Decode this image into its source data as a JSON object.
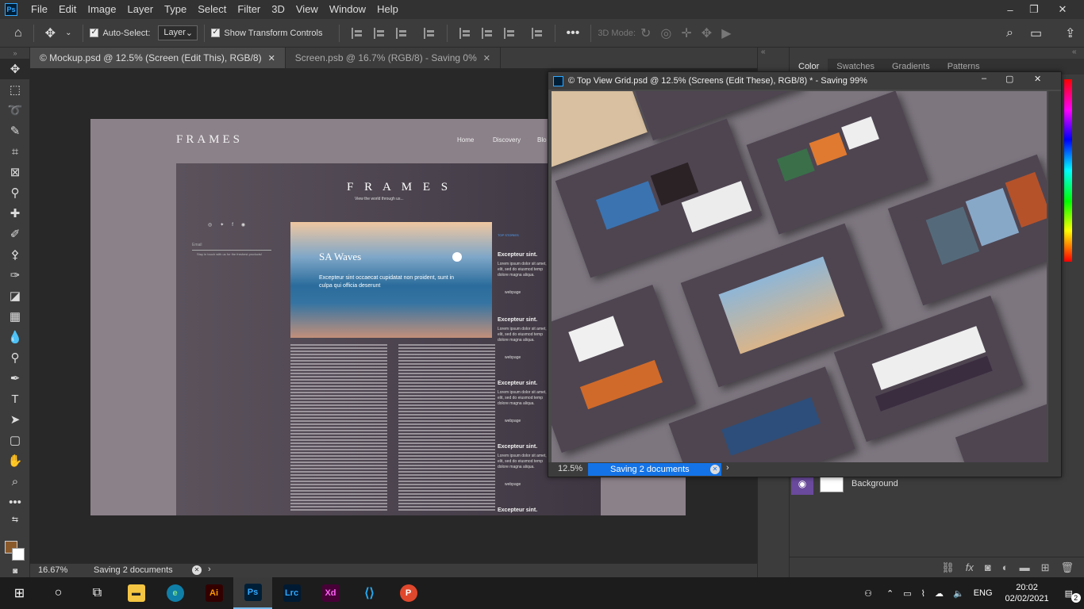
{
  "app": {
    "logo": "Ps",
    "brand_color": "#31a8ff"
  },
  "menu": [
    "File",
    "Edit",
    "Image",
    "Layer",
    "Type",
    "Select",
    "Filter",
    "3D",
    "View",
    "Window",
    "Help"
  ],
  "window_controls": [
    "–",
    "❐",
    "✕"
  ],
  "options": {
    "auto_select_label": "Auto-Select:",
    "auto_select_value": "Layer",
    "transform_label": "Show Transform Controls",
    "mode_3d_label": "3D Mode:"
  },
  "tabs": [
    {
      "label": "© Mockup.psd @ 12.5% (Screen (Edit This), RGB/8)"
    },
    {
      "label": "Screen.psb @ 16.7% (RGB/8) - Saving 0%"
    }
  ],
  "mockup": {
    "logo": "FRAMES",
    "nav": [
      "Home",
      "Discovery",
      "Blo"
    ],
    "inner_logo": "F R A M E S",
    "inner_tagline": "View the world through us...",
    "email_placeholder": "Email",
    "newsletter": "Stay in touch with us for the freshest products!",
    "hero_title": "SA Waves",
    "hero_text": "Excepteur sint occaecat cupidatat non proident, sunt in culpa qui officia deserunt",
    "top_stories": "TOP STORIES",
    "side_heads": [
      "Excepteur sint.",
      "Excepteur sint.",
      "Excepteur sint.",
      "Excepteur sint.",
      "Excepteur sint."
    ],
    "side_text": "Lorem ipsum dolor sit amet, elit, sed do eiusmod temp dolore magna aliqua.",
    "webpage_label": "webpage"
  },
  "float_window": {
    "title": "© Top View Grid.psd @ 12.5% (Screens (Edit These), RGB/8) * - Saving 99%",
    "zoom": "12.5%",
    "saving": "Saving 2 documents"
  },
  "panel": {
    "tabs": [
      "Color",
      "Swatches",
      "Gradients",
      "Patterns"
    ],
    "layer_name": "Background"
  },
  "status": {
    "zoom": "16.67%",
    "saving": "Saving 2 documents"
  },
  "taskbar": {
    "apps": [
      "Ai",
      "Ps",
      "Lrc",
      "Xd"
    ],
    "lang": "ENG",
    "time": "20:02",
    "date": "02/02/2021",
    "notifications": "2"
  }
}
